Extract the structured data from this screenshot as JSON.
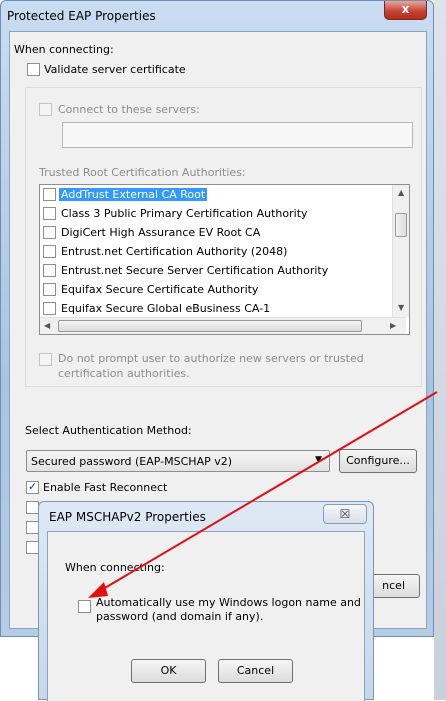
{
  "window": {
    "title": "Protected EAP Properties",
    "close_glyph": "x"
  },
  "connecting": {
    "heading": "When connecting:",
    "validate_label": "Validate server certificate",
    "connect_servers_label": "Connect to these servers:",
    "servers_value": "",
    "trusted_root_label": "Trusted Root Certification Authorities:",
    "authorities": [
      {
        "label": "AddTrust External CA Root",
        "checked": false,
        "selected": true
      },
      {
        "label": "Class 3 Public Primary Certification Authority",
        "checked": false,
        "selected": false
      },
      {
        "label": "DigiCert High Assurance EV Root CA",
        "checked": false,
        "selected": false
      },
      {
        "label": "Entrust.net Certification Authority (2048)",
        "checked": false,
        "selected": false
      },
      {
        "label": "Entrust.net Secure Server Certification Authority",
        "checked": false,
        "selected": false
      },
      {
        "label": "Equifax Secure Certificate Authority",
        "checked": false,
        "selected": false
      },
      {
        "label": "Equifax Secure Global eBusiness CA-1",
        "checked": false,
        "selected": false
      }
    ],
    "no_prompt_label_1": "Do not prompt user to authorize new servers or trusted",
    "no_prompt_label_2": "certification authorities."
  },
  "auth": {
    "heading": "Select Authentication Method:",
    "method_value": "Secured password (EAP-MSCHAP v2)",
    "configure_label": "Configure...",
    "fast_reconnect_label": "Enable Fast Reconnect",
    "fast_reconnect_checked": true,
    "cancel_partial_label": "ncel"
  },
  "popup": {
    "title": "EAP MSCHAPv2 Properties",
    "close_glyph": "☒",
    "heading": "When connecting:",
    "auto_logon_label_1": "Automatically use my Windows logon name and",
    "auto_logon_label_2": "password (and domain if any).",
    "ok_label": "OK",
    "cancel_label": "Cancel"
  },
  "colors": {
    "annotation_arrow": "#e01010",
    "selection": "#3399ff"
  }
}
